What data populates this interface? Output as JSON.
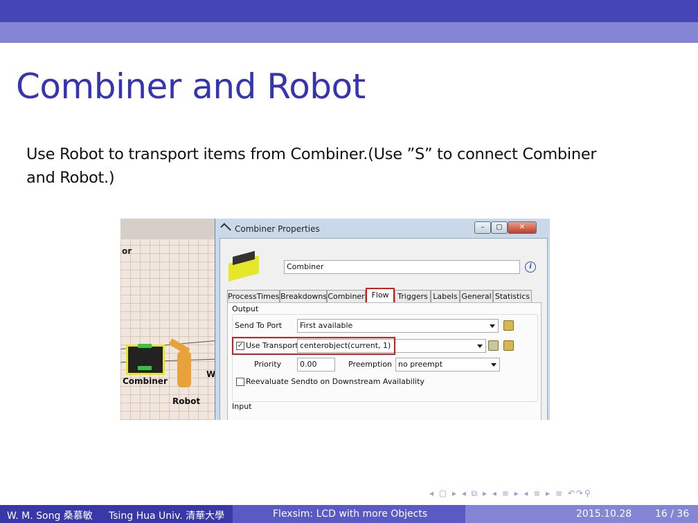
{
  "slide": {
    "title": "Combiner and Robot",
    "body_line1": "Use Robot to transport items from Combiner.(Use ”S” to connect Combiner",
    "body_line2": "and Robot.)"
  },
  "scene": {
    "label_or": "or",
    "label_combiner": "Combiner",
    "label_robot": "Robot",
    "label_w": "W"
  },
  "window": {
    "title": "Combiner  Properties",
    "object_name": "Combiner",
    "tabs": [
      "ProcessTimes",
      "Breakdowns",
      "Combiner",
      "Flow",
      "Triggers",
      "Labels",
      "General",
      "Statistics"
    ],
    "active_tab": "Flow",
    "output_group_label": "Output",
    "send_to_port_label": "Send To Port",
    "send_to_port_value": "First available",
    "use_transport_label": "Use Transport",
    "use_transport_value": "centerobject(current, 1)",
    "priority_label": "Priority",
    "priority_value": "0.00",
    "preemption_label": "Preemption",
    "preemption_value": "no preempt",
    "reevaluate_label": "Reevaluate Sendto on Downstream Availability",
    "input_group_label": "Input"
  },
  "footer": {
    "author": "W. M. Song 桑慕敏",
    "institute": "Tsing Hua Univ. 清華大學",
    "talk_title": "Flexsim: LCD with more Objects",
    "date": "2015.10.28",
    "page": "16 / 36",
    "nav_symbols": "◂ ▢ ▸ ◂ ⧉ ▸ ◂ ≡ ▸ ◂ ≡ ▸  ≡  ↶↷⚲"
  },
  "colors": {
    "header_dark": "#4545b8",
    "header_light": "#8585d6",
    "title": "#3535b0",
    "highlight_red": "#d11c1c"
  }
}
